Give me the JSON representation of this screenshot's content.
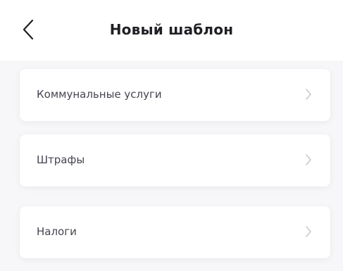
{
  "header": {
    "title": "Новый шаблон",
    "back_icon": "chevron-left-icon"
  },
  "templates": [
    {
      "label": "Коммунальные услуги",
      "icon": "chevron-right-icon"
    },
    {
      "label": "Штрафы",
      "icon": "chevron-right-icon"
    },
    {
      "label": "Налоги",
      "icon": "chevron-right-icon"
    }
  ],
  "colors": {
    "background": "#f7f7f9",
    "card": "#ffffff",
    "title": "#1f1f24",
    "label": "#44464f",
    "chevron": "#c8c9ce"
  }
}
